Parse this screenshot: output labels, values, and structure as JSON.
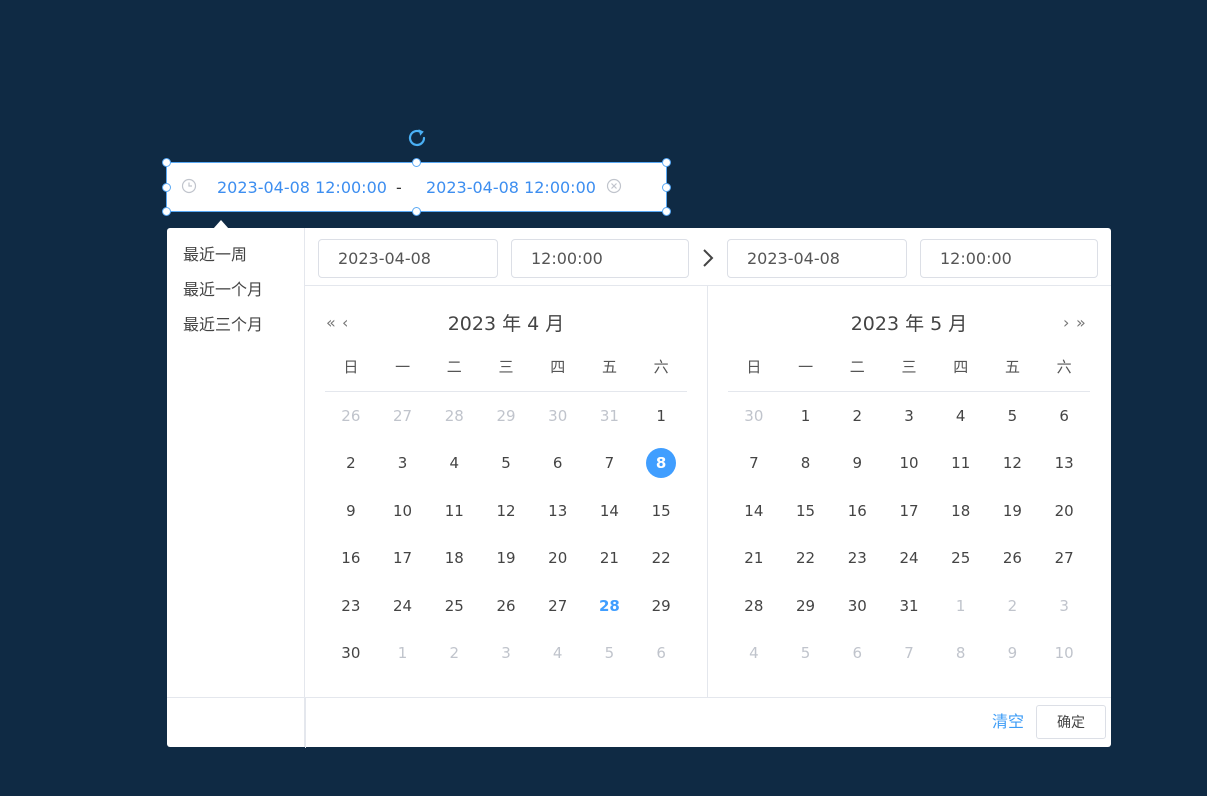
{
  "picker": {
    "start_value": "2023-04-08 12:00:00",
    "separator": "-",
    "end_value": "2023-04-08 12:00:00"
  },
  "shortcuts": [
    "最近一周",
    "最近一个月",
    "最近三个月"
  ],
  "header": {
    "start_date": "2023-04-08",
    "start_time": "12:00:00",
    "end_date": "2023-04-08",
    "end_time": "12:00:00"
  },
  "weekdays": [
    "日",
    "一",
    "二",
    "三",
    "四",
    "五",
    "六"
  ],
  "left_calendar": {
    "title": "2023 年 4 月",
    "prev_year": "«",
    "prev_month": "‹",
    "days": [
      {
        "d": "26",
        "t": "muted"
      },
      {
        "d": "27",
        "t": "muted"
      },
      {
        "d": "28",
        "t": "muted"
      },
      {
        "d": "29",
        "t": "muted"
      },
      {
        "d": "30",
        "t": "muted"
      },
      {
        "d": "31",
        "t": "muted"
      },
      {
        "d": "1",
        "t": ""
      },
      {
        "d": "2",
        "t": ""
      },
      {
        "d": "3",
        "t": ""
      },
      {
        "d": "4",
        "t": ""
      },
      {
        "d": "5",
        "t": ""
      },
      {
        "d": "6",
        "t": ""
      },
      {
        "d": "7",
        "t": ""
      },
      {
        "d": "8",
        "t": "selected"
      },
      {
        "d": "9",
        "t": ""
      },
      {
        "d": "10",
        "t": ""
      },
      {
        "d": "11",
        "t": ""
      },
      {
        "d": "12",
        "t": ""
      },
      {
        "d": "13",
        "t": ""
      },
      {
        "d": "14",
        "t": ""
      },
      {
        "d": "15",
        "t": ""
      },
      {
        "d": "16",
        "t": ""
      },
      {
        "d": "17",
        "t": ""
      },
      {
        "d": "18",
        "t": ""
      },
      {
        "d": "19",
        "t": ""
      },
      {
        "d": "20",
        "t": ""
      },
      {
        "d": "21",
        "t": ""
      },
      {
        "d": "22",
        "t": ""
      },
      {
        "d": "23",
        "t": ""
      },
      {
        "d": "24",
        "t": ""
      },
      {
        "d": "25",
        "t": ""
      },
      {
        "d": "26",
        "t": ""
      },
      {
        "d": "27",
        "t": ""
      },
      {
        "d": "28",
        "t": "today"
      },
      {
        "d": "29",
        "t": ""
      },
      {
        "d": "30",
        "t": ""
      },
      {
        "d": "1",
        "t": "muted"
      },
      {
        "d": "2",
        "t": "muted"
      },
      {
        "d": "3",
        "t": "muted"
      },
      {
        "d": "4",
        "t": "muted"
      },
      {
        "d": "5",
        "t": "muted"
      },
      {
        "d": "6",
        "t": "muted"
      }
    ]
  },
  "right_calendar": {
    "title": "2023 年 5 月",
    "next_month": "›",
    "next_year": "»",
    "days": [
      {
        "d": "30",
        "t": "muted"
      },
      {
        "d": "1",
        "t": ""
      },
      {
        "d": "2",
        "t": ""
      },
      {
        "d": "3",
        "t": ""
      },
      {
        "d": "4",
        "t": ""
      },
      {
        "d": "5",
        "t": ""
      },
      {
        "d": "6",
        "t": ""
      },
      {
        "d": "7",
        "t": ""
      },
      {
        "d": "8",
        "t": ""
      },
      {
        "d": "9",
        "t": ""
      },
      {
        "d": "10",
        "t": ""
      },
      {
        "d": "11",
        "t": ""
      },
      {
        "d": "12",
        "t": ""
      },
      {
        "d": "13",
        "t": ""
      },
      {
        "d": "14",
        "t": ""
      },
      {
        "d": "15",
        "t": ""
      },
      {
        "d": "16",
        "t": ""
      },
      {
        "d": "17",
        "t": ""
      },
      {
        "d": "18",
        "t": ""
      },
      {
        "d": "19",
        "t": ""
      },
      {
        "d": "20",
        "t": ""
      },
      {
        "d": "21",
        "t": ""
      },
      {
        "d": "22",
        "t": ""
      },
      {
        "d": "23",
        "t": ""
      },
      {
        "d": "24",
        "t": ""
      },
      {
        "d": "25",
        "t": ""
      },
      {
        "d": "26",
        "t": ""
      },
      {
        "d": "27",
        "t": ""
      },
      {
        "d": "28",
        "t": ""
      },
      {
        "d": "29",
        "t": ""
      },
      {
        "d": "30",
        "t": ""
      },
      {
        "d": "31",
        "t": ""
      },
      {
        "d": "1",
        "t": "muted"
      },
      {
        "d": "2",
        "t": "muted"
      },
      {
        "d": "3",
        "t": "muted"
      },
      {
        "d": "4",
        "t": "muted"
      },
      {
        "d": "5",
        "t": "muted"
      },
      {
        "d": "6",
        "t": "muted"
      },
      {
        "d": "7",
        "t": "muted"
      },
      {
        "d": "8",
        "t": "muted"
      },
      {
        "d": "9",
        "t": "muted"
      },
      {
        "d": "10",
        "t": "muted"
      }
    ]
  },
  "footer": {
    "clear_label": "清空",
    "confirm_label": "确定"
  },
  "colors": {
    "background": "#0f2a44",
    "accent": "#409eff",
    "selection_outline": "#5aa9f4"
  }
}
